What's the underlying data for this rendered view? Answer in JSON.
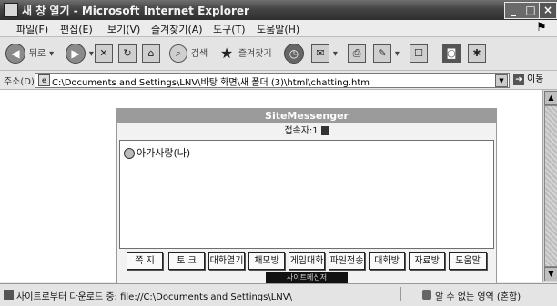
{
  "window": {
    "title": "새 창 열기 - Microsoft Internet Explorer"
  },
  "window_controls": {
    "minimize": "_",
    "maximize": "□",
    "close": "×"
  },
  "menubar": {
    "items": [
      "파일(F)",
      "편집(E)",
      "보기(V)",
      "즐겨찾기(A)",
      "도구(T)",
      "도움말(H)"
    ]
  },
  "toolbar": {
    "back_label": "뒤로",
    "search_label": "검색",
    "favorites_label": "즐겨찾기"
  },
  "address": {
    "label": "주소(D)",
    "url": "C:\\Documents and Settings\\LNV\\바탕 화면\\새 폴더 (3)\\html\\chatting.htm",
    "go_label": "이동"
  },
  "messenger": {
    "title": "SiteMessenger",
    "count_text": "접속자:1",
    "chat_lines": [
      "아가사랑(나)"
    ],
    "buttons": [
      "쪽 지",
      "토 크",
      "대화열기",
      "채모방",
      "게임대화",
      "파일전송",
      "대화방",
      "자료방",
      "도움말"
    ],
    "banner_text": "사이트메신저"
  },
  "status": {
    "text": "사이트로부터 다운로드 중: file://C:\\Documents and Settings\\LNV\\",
    "zone": "알 수 없는 영역 (혼합)"
  }
}
